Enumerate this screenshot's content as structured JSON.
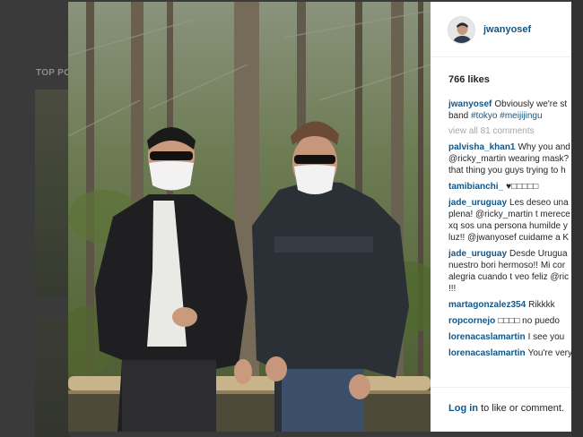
{
  "background": {
    "section_label": "TOP PO"
  },
  "post": {
    "username": "jwanyosef",
    "likes": "766 likes",
    "caption": {
      "username": "jwanyosef",
      "line1": "Obviously we're st",
      "line2_text": "band",
      "hashtags": "#tokyo #meijijingu"
    },
    "view_all": "view all 81 comments",
    "comments": [
      {
        "user": "palvisha_khan1",
        "lines": [
          "Why you and",
          "@ricky_martin wearing mask?",
          "that thing you guys trying to h"
        ]
      },
      {
        "user": "tamibianchi_",
        "lines": [
          "♥□□□□□"
        ]
      },
      {
        "user": "jade_uruguay",
        "lines": [
          "Les deseo una",
          "plena! @ricky_martin t merece",
          "xq sos una persona humilde y",
          "luz!! @jwanyosef cuidame a K"
        ]
      },
      {
        "user": "jade_uruguay",
        "lines": [
          "Desde Urugua",
          "nuestro bori hermoso!! Mi cor",
          "alegria cuando t veo feliz @ric",
          "!!!"
        ]
      },
      {
        "user": "martagonzalez354",
        "lines": [
          "Rikkkk"
        ]
      },
      {
        "user": "ropcornejo",
        "lines": [
          "□□□□ no puedo"
        ]
      },
      {
        "user": "lorenacaslamartin",
        "lines": [
          "I see you"
        ]
      },
      {
        "user": "lorenacaslamartin",
        "lines": [
          "You're very"
        ]
      }
    ],
    "login_link": "Log in",
    "login_rest": "to like or comment."
  },
  "colors": {
    "link": "#125688",
    "text": "#262626",
    "muted": "#a5a7aa"
  }
}
